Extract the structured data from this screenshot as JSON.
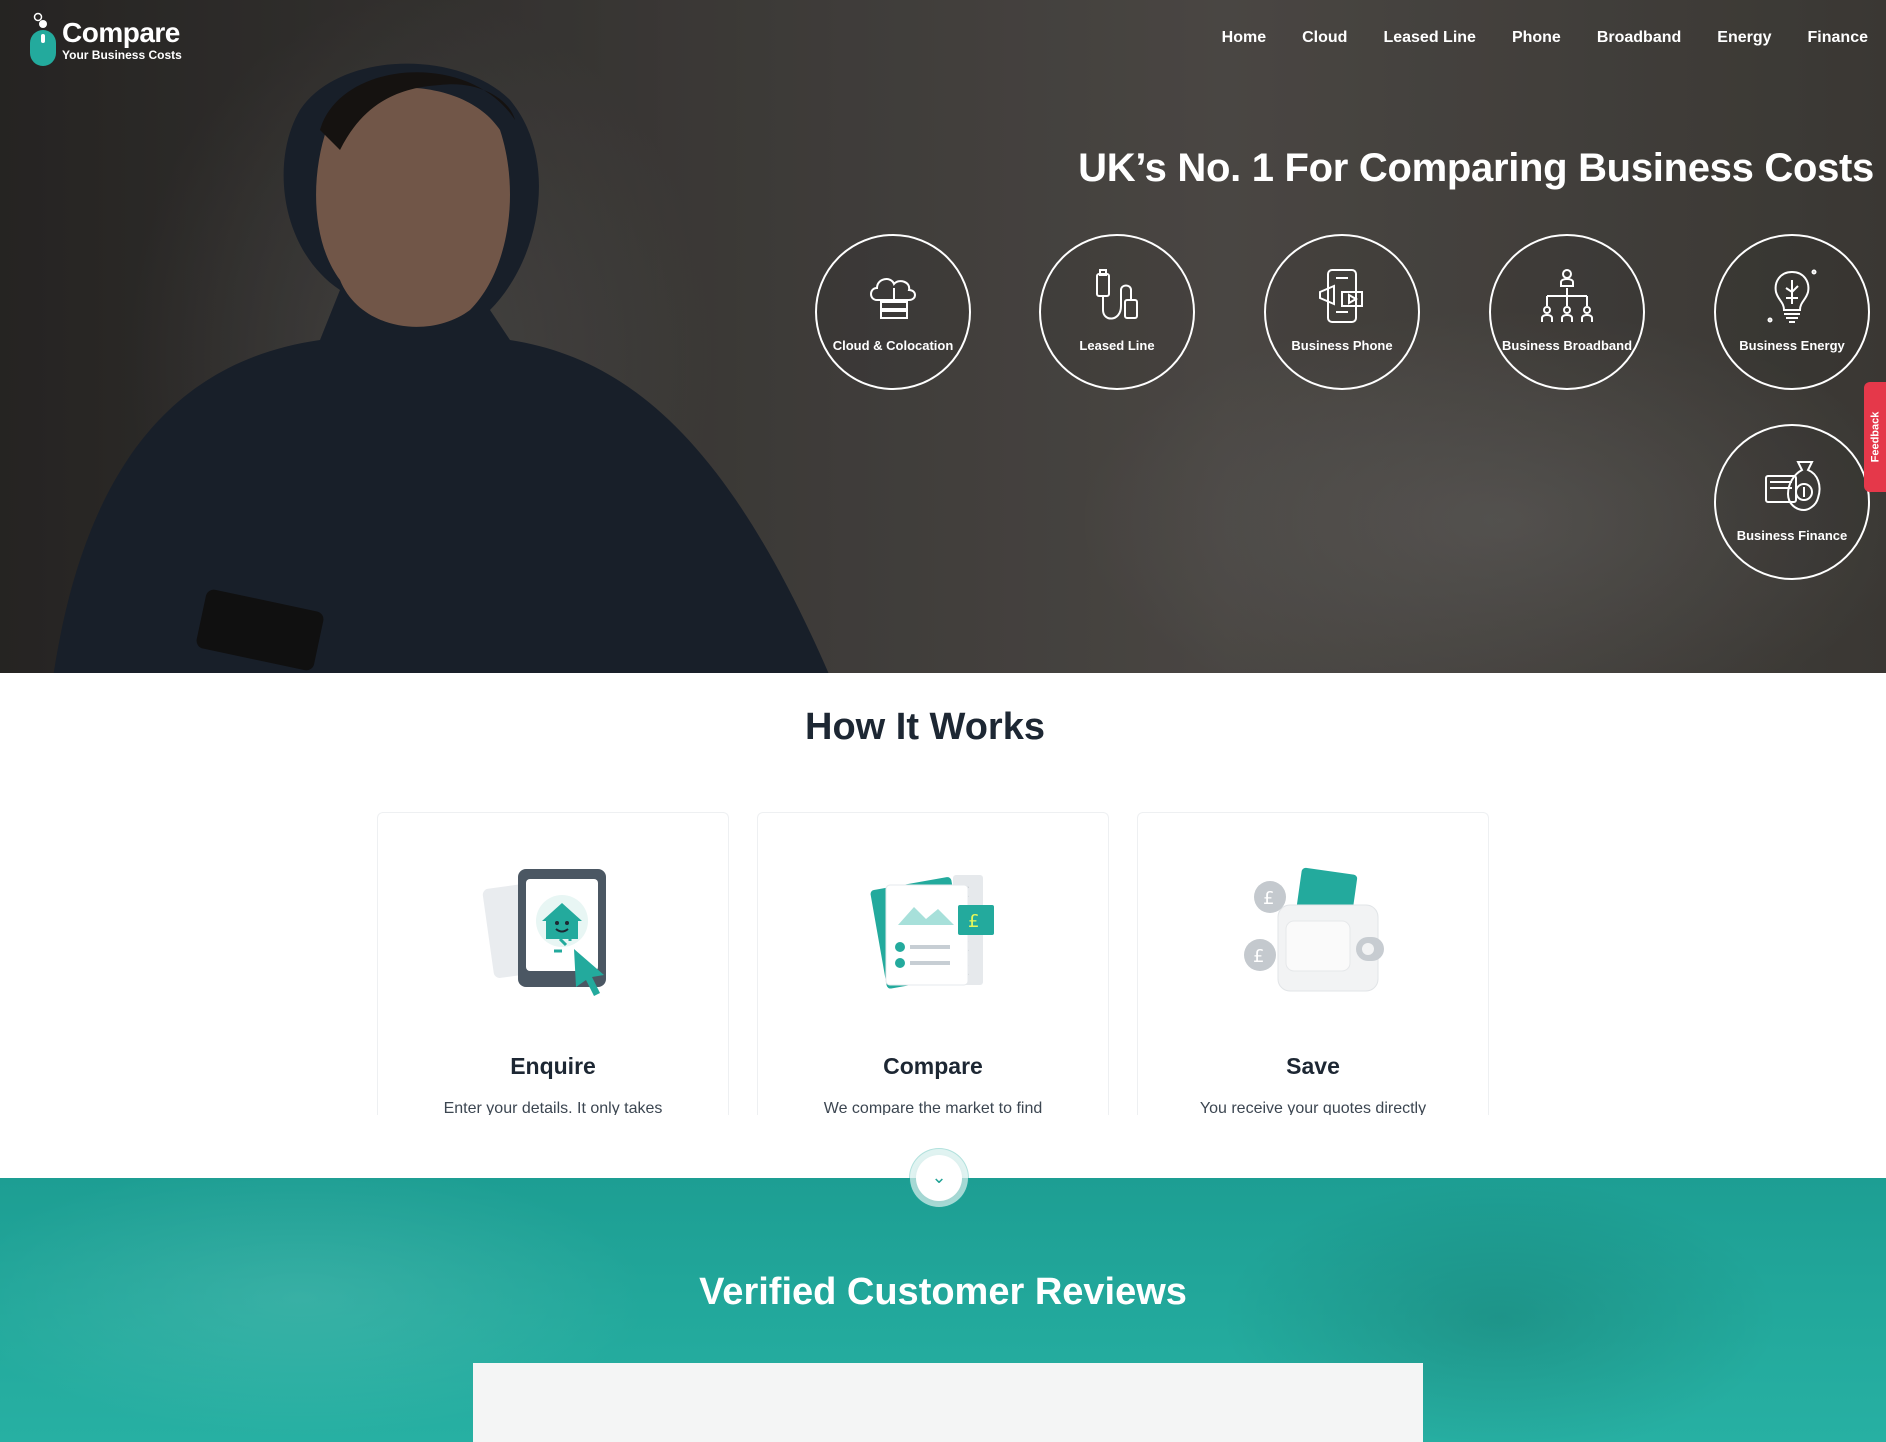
{
  "brand": {
    "name": "Compare",
    "tagline": "Your Business Costs"
  },
  "nav": [
    "Home",
    "Cloud",
    "Leased Line",
    "Phone",
    "Broadband",
    "Energy",
    "Finance"
  ],
  "hero": {
    "title": "UK’s No. 1 For Comparing Business Costs",
    "services": [
      {
        "label": "Cloud & Colocation",
        "icon": "cloud-server-icon"
      },
      {
        "label": "Leased Line",
        "icon": "cable-connector-icon"
      },
      {
        "label": "Business Phone",
        "icon": "phone-megaphone-icon"
      },
      {
        "label": "Business Broadband",
        "icon": "network-hierarchy-icon"
      },
      {
        "label": "Business Energy",
        "icon": "lightbulb-icon"
      },
      {
        "label": "Business Finance",
        "icon": "money-bag-icon"
      }
    ]
  },
  "feedback": {
    "label": "Feedback"
  },
  "how_it_works": {
    "title": "How It Works",
    "steps": [
      {
        "title": "Enquire",
        "text": "Enter your details. It only takes"
      },
      {
        "title": "Compare",
        "text": "We compare the market to find"
      },
      {
        "title": "Save",
        "text": "You receive your quotes directly"
      }
    ]
  },
  "reviews": {
    "title": "Verified Customer Reviews"
  },
  "colors": {
    "accent": "#23aa9d",
    "feedback": "#e5384a",
    "text": "#1d2733"
  }
}
